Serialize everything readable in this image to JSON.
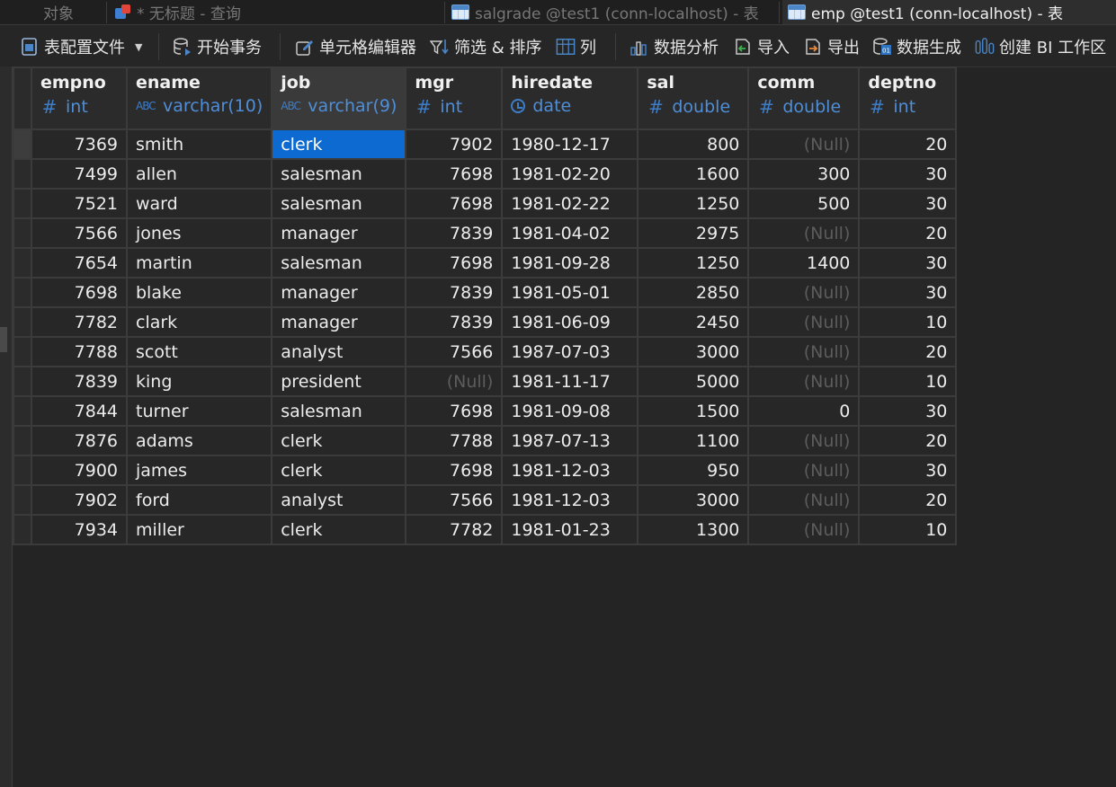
{
  "tabs": [
    {
      "label": "对象",
      "icon": "none",
      "active": false
    },
    {
      "label": "* 无标题 - 查询",
      "icon": "query-icon",
      "active": false
    },
    {
      "label": "salgrade @test1 (conn-localhost) - 表",
      "icon": "table-icon",
      "active": false
    },
    {
      "label": "emp @test1 (conn-localhost) - 表",
      "icon": "table-icon",
      "active": true
    }
  ],
  "toolbar": {
    "table_config": "表配置文件",
    "begin_transaction": "开始事务",
    "cell_editor": "单元格编辑器",
    "filter_sort": "筛选 & 排序",
    "columns": "列",
    "data_analysis": "数据分析",
    "import": "导入",
    "export": "导出",
    "data_generation": "数据生成",
    "create_bi": "创建 BI 工作区"
  },
  "columns": [
    {
      "name": "empno",
      "type": "int",
      "type_icon": "hash-icon"
    },
    {
      "name": "ename",
      "type": "varchar(10)",
      "type_icon": "abc-icon"
    },
    {
      "name": "job",
      "type": "varchar(9)",
      "type_icon": "abc-icon"
    },
    {
      "name": "mgr",
      "type": "int",
      "type_icon": "hash-icon"
    },
    {
      "name": "hiredate",
      "type": "date",
      "type_icon": "clock-icon"
    },
    {
      "name": "sal",
      "type": "double",
      "type_icon": "hash-icon"
    },
    {
      "name": "comm",
      "type": "double",
      "type_icon": "hash-icon"
    },
    {
      "name": "deptno",
      "type": "int",
      "type_icon": "hash-icon"
    }
  ],
  "null_label": "(Null)",
  "rows": [
    [
      "7369",
      "smith",
      "clerk",
      "7902",
      "1980-12-17",
      "800",
      null,
      "20"
    ],
    [
      "7499",
      "allen",
      "salesman",
      "7698",
      "1981-02-20",
      "1600",
      "300",
      "30"
    ],
    [
      "7521",
      "ward",
      "salesman",
      "7698",
      "1981-02-22",
      "1250",
      "500",
      "30"
    ],
    [
      "7566",
      "jones",
      "manager",
      "7839",
      "1981-04-02",
      "2975",
      null,
      "20"
    ],
    [
      "7654",
      "martin",
      "salesman",
      "7698",
      "1981-09-28",
      "1250",
      "1400",
      "30"
    ],
    [
      "7698",
      "blake",
      "manager",
      "7839",
      "1981-05-01",
      "2850",
      null,
      "30"
    ],
    [
      "7782",
      "clark",
      "manager",
      "7839",
      "1981-06-09",
      "2450",
      null,
      "10"
    ],
    [
      "7788",
      "scott",
      "analyst",
      "7566",
      "1987-07-03",
      "3000",
      null,
      "20"
    ],
    [
      "7839",
      "king",
      "president",
      null,
      "1981-11-17",
      "5000",
      null,
      "10"
    ],
    [
      "7844",
      "turner",
      "salesman",
      "7698",
      "1981-09-08",
      "1500",
      "0",
      "30"
    ],
    [
      "7876",
      "adams",
      "clerk",
      "7788",
      "1987-07-13",
      "1100",
      null,
      "20"
    ],
    [
      "7900",
      "james",
      "clerk",
      "7698",
      "1981-12-03",
      "950",
      null,
      "30"
    ],
    [
      "7902",
      "ford",
      "analyst",
      "7566",
      "1981-12-03",
      "3000",
      null,
      "20"
    ],
    [
      "7934",
      "miller",
      "clerk",
      "7782",
      "1981-01-23",
      "1300",
      null,
      "10"
    ]
  ],
  "selected_cell": {
    "row": 0,
    "column": "job"
  },
  "colors": {
    "selection": "#0d6ad1",
    "type_text": "#4f8ed8",
    "null_text": "#5c5c5c",
    "background": "#242424"
  }
}
